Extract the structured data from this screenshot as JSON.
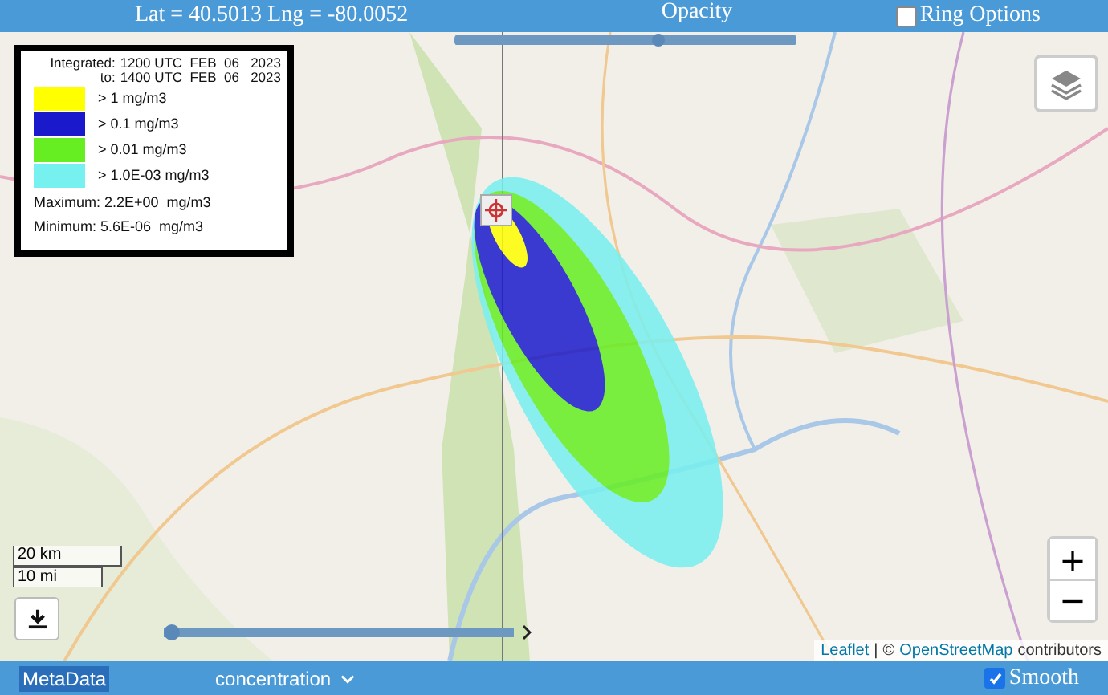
{
  "top_bar": {
    "coordinates": "Lat = 40.5013 Lng = -80.0052",
    "opacity": {
      "label": "Opacity",
      "level": 0.6
    },
    "ring_options": {
      "label": "Ring Options",
      "checked": false
    }
  },
  "map": {
    "kind": "picture",
    "legend": {
      "integrated": {
        "label": "Integrated:",
        "value": "1200 UTC  FEB  06   2023"
      },
      "to": {
        "label": "to:",
        "value": "1400 UTC  FEB  06   2023"
      },
      "levels": [
        {
          "label": "> 1 mg/m3",
          "color": "#ffff00"
        },
        {
          "label": "> 0.1 mg/m3",
          "color": "#1a1acc"
        },
        {
          "label": "> 0.01 mg/m3",
          "color": "#66ee22"
        },
        {
          "label": "> 1.0E-03 mg/m3",
          "color": "#77f0f0"
        }
      ],
      "maximum": "Maximum: 2.2E+00  mg/m3",
      "minimum": "Minimum: 5.6E-06  mg/m3"
    },
    "scale": {
      "metric": "20 km",
      "imperial": "10 mi"
    },
    "zoom_in": "+",
    "zoom_out": "−",
    "time_slider": {
      "level": 0
    },
    "attribution": {
      "leaflet": "Leaflet",
      "separator": "|",
      "copyright": "©",
      "osm": "OpenStreetMap",
      "suffix": "contributors"
    }
  },
  "bottom_bar": {
    "metadata": "MetaData",
    "field": "concentration",
    "smooth": {
      "label": "Smooth",
      "checked": true
    }
  }
}
